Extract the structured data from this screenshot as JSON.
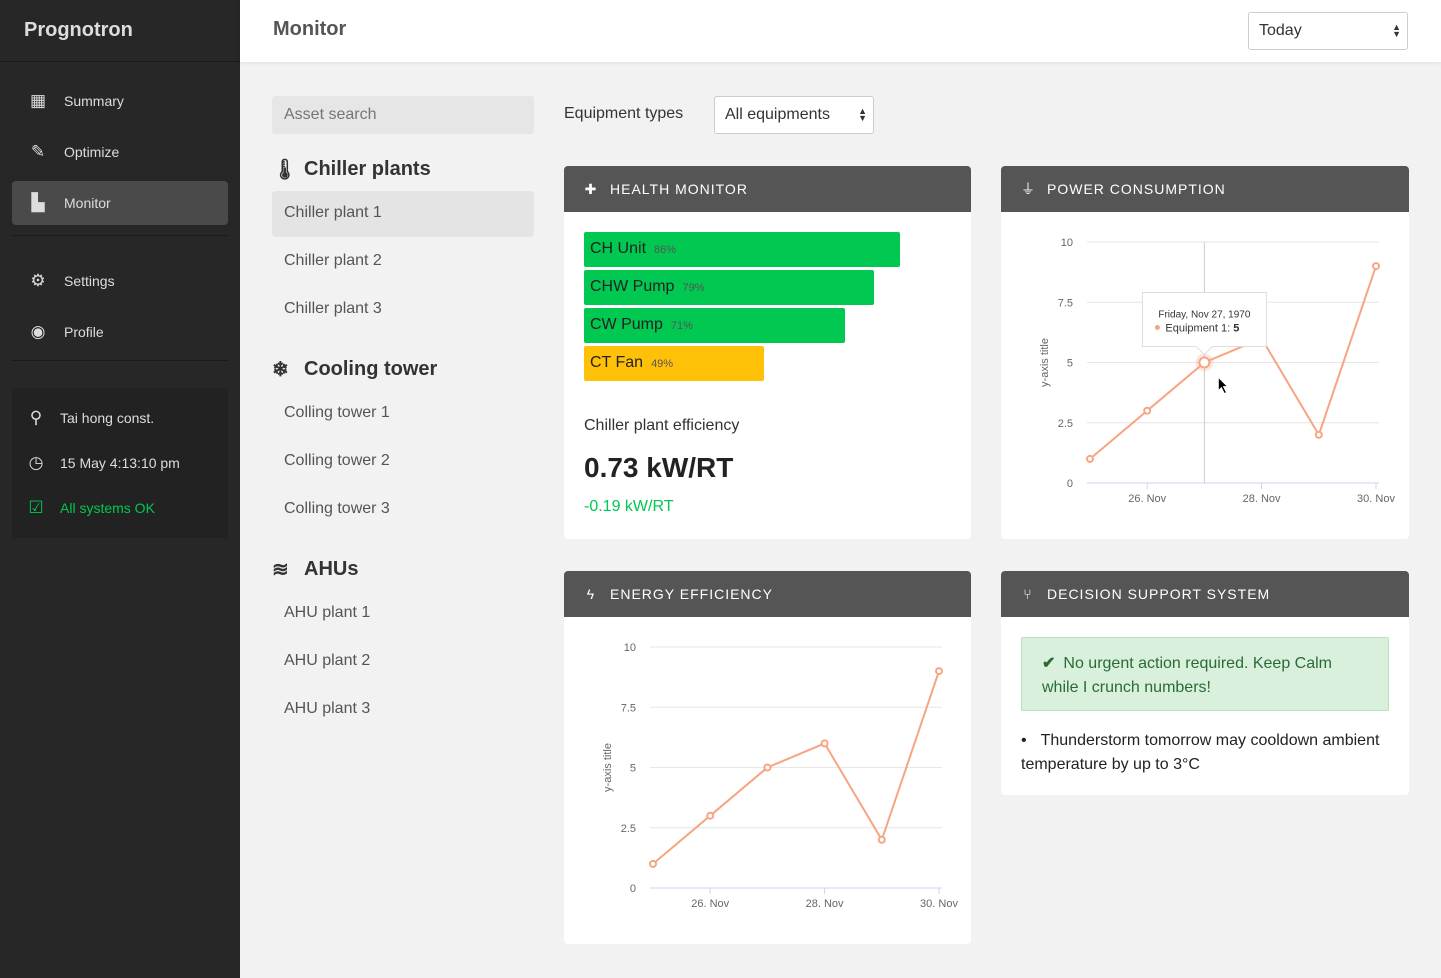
{
  "app": {
    "name": "Prognotron"
  },
  "header": {
    "title": "Monitor",
    "range_select": "Today"
  },
  "sidebar": {
    "items": [
      {
        "label": "Summary",
        "icon": "grid-icon"
      },
      {
        "label": "Optimize",
        "icon": "magic-wand-icon"
      },
      {
        "label": "Monitor",
        "icon": "bar-chart-icon",
        "active": true
      },
      {
        "label": "Settings",
        "icon": "gear-icon"
      },
      {
        "label": "Profile",
        "icon": "user-circle-icon"
      }
    ],
    "info": {
      "location": "Tai hong const.",
      "datetime": "15 May 4:13:10 pm",
      "status": "All systems OK"
    }
  },
  "assets": {
    "search_placeholder": "Asset search",
    "groups": [
      {
        "title": "Chiller plants",
        "icon": "thermometer-icon",
        "items": [
          "Chiller plant 1",
          "Chiller plant 2",
          "Chiller plant 3"
        ]
      },
      {
        "title": "Cooling tower",
        "icon": "snowflake-icon",
        "items": [
          "Colling tower 1",
          "Colling tower 2",
          "Colling tower 3"
        ]
      },
      {
        "title": "AHUs",
        "icon": "wind-icon",
        "items": [
          "AHU plant 1",
          "AHU plant 2",
          "AHU plant 3"
        ]
      }
    ]
  },
  "filter": {
    "label": "Equipment types",
    "value": "All equipments"
  },
  "health": {
    "title": "HEALTH MONITOR",
    "bars": [
      {
        "label": "CH Unit",
        "value": 86,
        "pct": "86%",
        "color": "#00c851"
      },
      {
        "label": "CHW Pump",
        "value": 79,
        "pct": "79%",
        "color": "#00c851"
      },
      {
        "label": "CW Pump",
        "value": 71,
        "pct": "71%",
        "color": "#00c851"
      },
      {
        "label": "CT Fan",
        "value": 49,
        "pct": "49%",
        "color": "#ffc107"
      }
    ],
    "efficiency_label": "Chiller plant efficiency",
    "efficiency_value": "0.73 kW/RT",
    "efficiency_delta": "-0.19 kW/RT"
  },
  "dss": {
    "title": "DECISION SUPPORT SYSTEM",
    "alert": "No urgent action required. Keep Calm while I crunch numbers!",
    "bullet": "Thunderstorm tomorrow may cooldown ambient temperature by up to 3°C"
  },
  "chart_data": [
    {
      "title": "POWER CONSUMPTION",
      "type": "line",
      "ylabel": "y-axis title",
      "x": [
        "25 Nov",
        "26 Nov",
        "27 Nov",
        "28 Nov",
        "29 Nov",
        "30 Nov"
      ],
      "series": [
        {
          "name": "Equipment 1",
          "values": [
            1,
            3,
            5,
            6,
            2,
            9
          ]
        }
      ],
      "ylim": [
        0,
        10
      ],
      "yticks": [
        "0",
        "2.5",
        "5",
        "7.5",
        "10"
      ],
      "xticks": [
        "26. Nov",
        "28. Nov",
        "30. Nov"
      ],
      "color": "#f7a482",
      "grid": true,
      "tooltip": {
        "date": "Friday, Nov 27, 1970",
        "series": "Equipment 1: ",
        "value": "5"
      }
    },
    {
      "title": "ENERGY EFFICIENCY",
      "type": "line",
      "ylabel": "y-axis title",
      "x": [
        "25 Nov",
        "26 Nov",
        "27 Nov",
        "28 Nov",
        "29 Nov",
        "30 Nov"
      ],
      "series": [
        {
          "values": [
            1,
            3,
            5,
            6,
            2,
            9
          ]
        }
      ],
      "ylim": [
        0,
        10
      ],
      "yticks": [
        "0",
        "2.5",
        "5",
        "7.5",
        "10"
      ],
      "xticks": [
        "26. Nov",
        "28. Nov",
        "30. Nov"
      ],
      "color": "#f7a482",
      "grid": true
    }
  ]
}
